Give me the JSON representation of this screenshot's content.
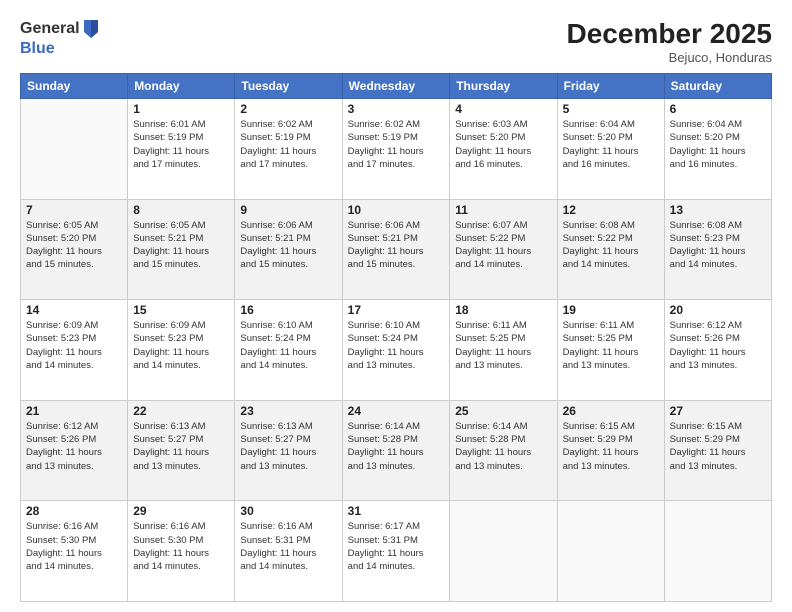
{
  "logo": {
    "general": "General",
    "blue": "Blue"
  },
  "title": {
    "month_year": "December 2025",
    "location": "Bejuco, Honduras"
  },
  "weekdays": [
    "Sunday",
    "Monday",
    "Tuesday",
    "Wednesday",
    "Thursday",
    "Friday",
    "Saturday"
  ],
  "weeks": [
    [
      {
        "day": "",
        "info": ""
      },
      {
        "day": "1",
        "info": "Sunrise: 6:01 AM\nSunset: 5:19 PM\nDaylight: 11 hours\nand 17 minutes."
      },
      {
        "day": "2",
        "info": "Sunrise: 6:02 AM\nSunset: 5:19 PM\nDaylight: 11 hours\nand 17 minutes."
      },
      {
        "day": "3",
        "info": "Sunrise: 6:02 AM\nSunset: 5:19 PM\nDaylight: 11 hours\nand 17 minutes."
      },
      {
        "day": "4",
        "info": "Sunrise: 6:03 AM\nSunset: 5:20 PM\nDaylight: 11 hours\nand 16 minutes."
      },
      {
        "day": "5",
        "info": "Sunrise: 6:04 AM\nSunset: 5:20 PM\nDaylight: 11 hours\nand 16 minutes."
      },
      {
        "day": "6",
        "info": "Sunrise: 6:04 AM\nSunset: 5:20 PM\nDaylight: 11 hours\nand 16 minutes."
      }
    ],
    [
      {
        "day": "7",
        "info": "Sunrise: 6:05 AM\nSunset: 5:20 PM\nDaylight: 11 hours\nand 15 minutes."
      },
      {
        "day": "8",
        "info": "Sunrise: 6:05 AM\nSunset: 5:21 PM\nDaylight: 11 hours\nand 15 minutes."
      },
      {
        "day": "9",
        "info": "Sunrise: 6:06 AM\nSunset: 5:21 PM\nDaylight: 11 hours\nand 15 minutes."
      },
      {
        "day": "10",
        "info": "Sunrise: 6:06 AM\nSunset: 5:21 PM\nDaylight: 11 hours\nand 15 minutes."
      },
      {
        "day": "11",
        "info": "Sunrise: 6:07 AM\nSunset: 5:22 PM\nDaylight: 11 hours\nand 14 minutes."
      },
      {
        "day": "12",
        "info": "Sunrise: 6:08 AM\nSunset: 5:22 PM\nDaylight: 11 hours\nand 14 minutes."
      },
      {
        "day": "13",
        "info": "Sunrise: 6:08 AM\nSunset: 5:23 PM\nDaylight: 11 hours\nand 14 minutes."
      }
    ],
    [
      {
        "day": "14",
        "info": "Sunrise: 6:09 AM\nSunset: 5:23 PM\nDaylight: 11 hours\nand 14 minutes."
      },
      {
        "day": "15",
        "info": "Sunrise: 6:09 AM\nSunset: 5:23 PM\nDaylight: 11 hours\nand 14 minutes."
      },
      {
        "day": "16",
        "info": "Sunrise: 6:10 AM\nSunset: 5:24 PM\nDaylight: 11 hours\nand 14 minutes."
      },
      {
        "day": "17",
        "info": "Sunrise: 6:10 AM\nSunset: 5:24 PM\nDaylight: 11 hours\nand 13 minutes."
      },
      {
        "day": "18",
        "info": "Sunrise: 6:11 AM\nSunset: 5:25 PM\nDaylight: 11 hours\nand 13 minutes."
      },
      {
        "day": "19",
        "info": "Sunrise: 6:11 AM\nSunset: 5:25 PM\nDaylight: 11 hours\nand 13 minutes."
      },
      {
        "day": "20",
        "info": "Sunrise: 6:12 AM\nSunset: 5:26 PM\nDaylight: 11 hours\nand 13 minutes."
      }
    ],
    [
      {
        "day": "21",
        "info": "Sunrise: 6:12 AM\nSunset: 5:26 PM\nDaylight: 11 hours\nand 13 minutes."
      },
      {
        "day": "22",
        "info": "Sunrise: 6:13 AM\nSunset: 5:27 PM\nDaylight: 11 hours\nand 13 minutes."
      },
      {
        "day": "23",
        "info": "Sunrise: 6:13 AM\nSunset: 5:27 PM\nDaylight: 11 hours\nand 13 minutes."
      },
      {
        "day": "24",
        "info": "Sunrise: 6:14 AM\nSunset: 5:28 PM\nDaylight: 11 hours\nand 13 minutes."
      },
      {
        "day": "25",
        "info": "Sunrise: 6:14 AM\nSunset: 5:28 PM\nDaylight: 11 hours\nand 13 minutes."
      },
      {
        "day": "26",
        "info": "Sunrise: 6:15 AM\nSunset: 5:29 PM\nDaylight: 11 hours\nand 13 minutes."
      },
      {
        "day": "27",
        "info": "Sunrise: 6:15 AM\nSunset: 5:29 PM\nDaylight: 11 hours\nand 13 minutes."
      }
    ],
    [
      {
        "day": "28",
        "info": "Sunrise: 6:16 AM\nSunset: 5:30 PM\nDaylight: 11 hours\nand 14 minutes."
      },
      {
        "day": "29",
        "info": "Sunrise: 6:16 AM\nSunset: 5:30 PM\nDaylight: 11 hours\nand 14 minutes."
      },
      {
        "day": "30",
        "info": "Sunrise: 6:16 AM\nSunset: 5:31 PM\nDaylight: 11 hours\nand 14 minutes."
      },
      {
        "day": "31",
        "info": "Sunrise: 6:17 AM\nSunset: 5:31 PM\nDaylight: 11 hours\nand 14 minutes."
      },
      {
        "day": "",
        "info": ""
      },
      {
        "day": "",
        "info": ""
      },
      {
        "day": "",
        "info": ""
      }
    ]
  ]
}
